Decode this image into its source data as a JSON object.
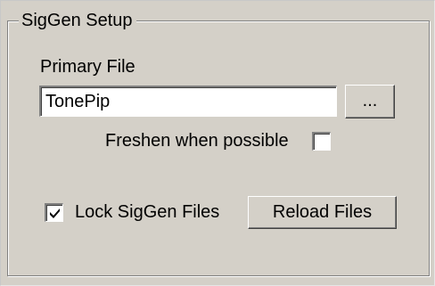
{
  "group": {
    "title": "SigGen Setup"
  },
  "primary_file": {
    "label": "Primary File",
    "value": "TonePip",
    "browse_label": "..."
  },
  "freshen": {
    "label": "Freshen when possible",
    "checked": false
  },
  "lock": {
    "label": "Lock SigGen Files",
    "checked": true
  },
  "reload": {
    "label": "Reload Files"
  }
}
